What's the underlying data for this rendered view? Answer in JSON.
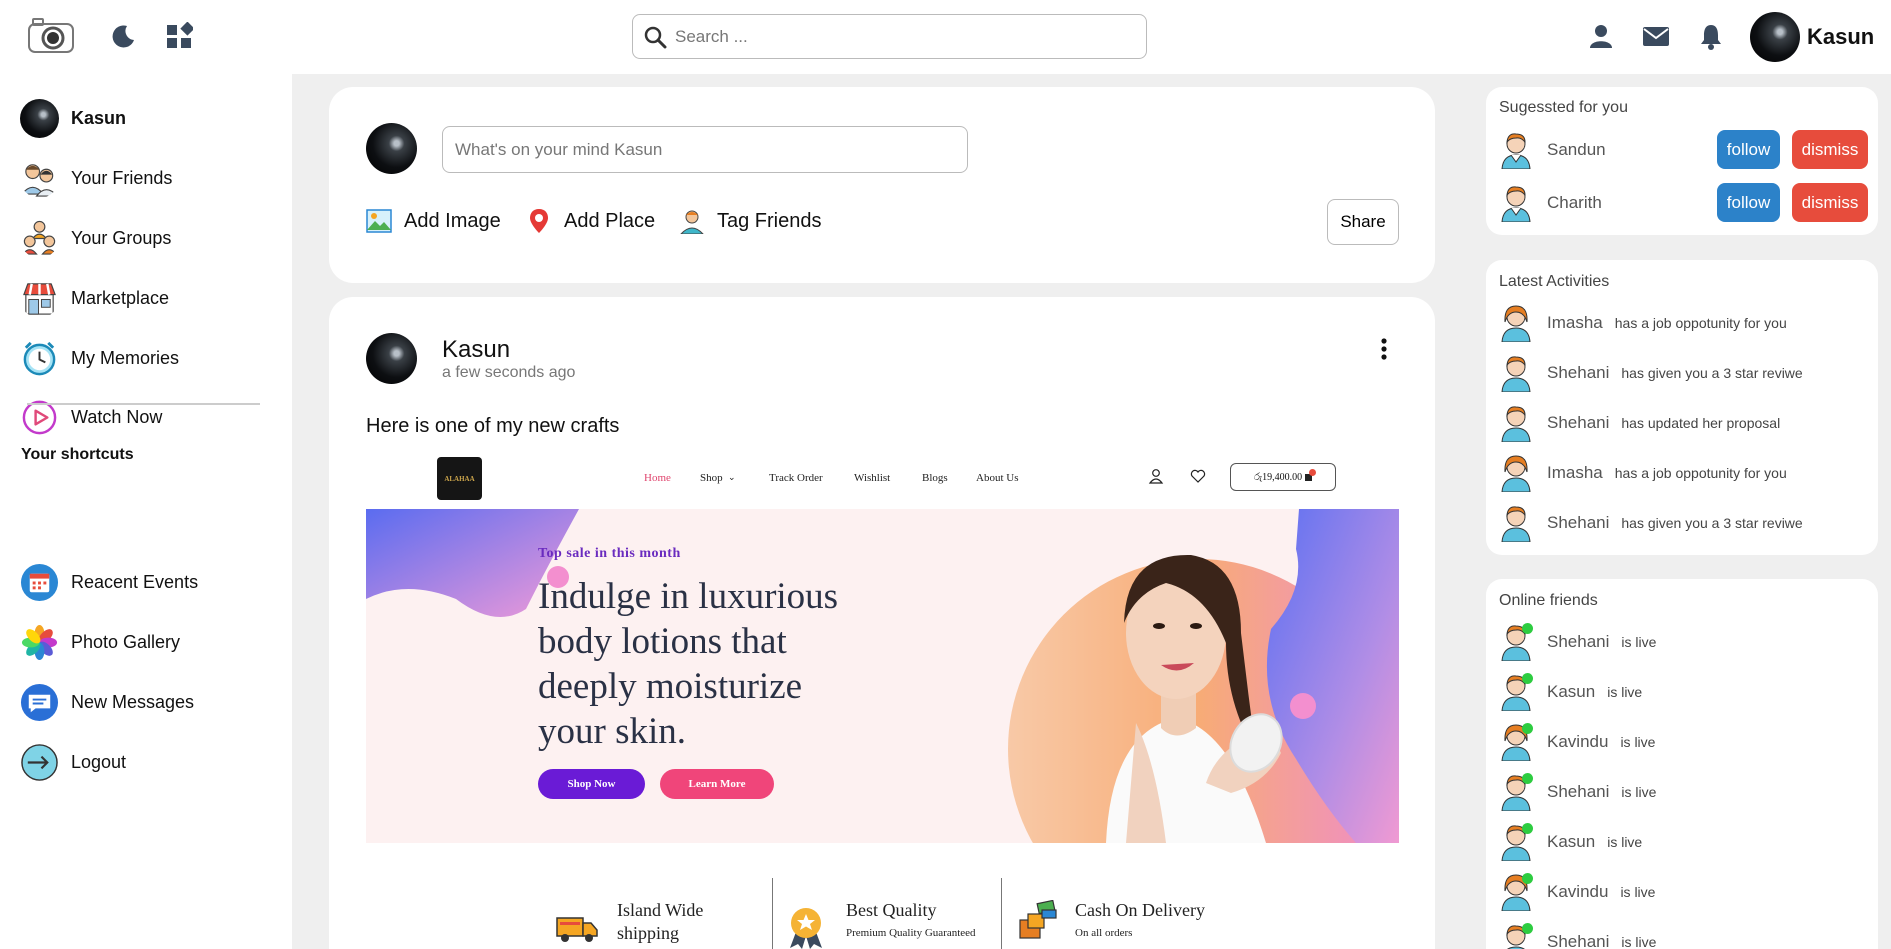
{
  "header": {
    "search_placeholder": "Search ...",
    "username": "Kasun"
  },
  "sidebar": {
    "profile_name": "Kasun",
    "items": [
      {
        "label": "Your Friends",
        "icon": "friends-icon"
      },
      {
        "label": "Your Groups",
        "icon": "groups-icon"
      },
      {
        "label": "Marketplace",
        "icon": "marketplace-icon"
      },
      {
        "label": "My Memories",
        "icon": "clock-icon"
      },
      {
        "label": "Watch Now",
        "icon": "play-icon"
      }
    ],
    "shortcuts_title": "Your shortcuts",
    "shortcuts": [
      {
        "label": "Reacent Events",
        "icon": "calendar-icon"
      },
      {
        "label": "Photo Gallery",
        "icon": "photos-icon"
      },
      {
        "label": "New Messages",
        "icon": "message-icon"
      },
      {
        "label": "Logout",
        "icon": "logout-icon"
      }
    ]
  },
  "composer": {
    "placeholder": "What's on your mind Kasun",
    "actions": [
      "Add Image",
      "Add Place",
      "Tag Friends"
    ],
    "share_label": "Share"
  },
  "post": {
    "author": "Kasun",
    "time": "a few seconds ago",
    "text": "Here is one of my new crafts",
    "image": {
      "nav": [
        "Home",
        "Shop",
        "Track Order",
        "Wishlist",
        "Blogs",
        "About Us"
      ],
      "logo_text": "ALAHAA",
      "cart": "රු19,400.00",
      "tagline": "Top sale in this month",
      "headline": [
        "Indulge in luxurious",
        "body lotions that",
        "deeply moisturize",
        "your skin."
      ],
      "btn_primary": "Shop Now",
      "btn_secondary": "Learn More",
      "features": [
        {
          "title": "Island Wide",
          "sub": "shipping"
        },
        {
          "title": "Best Quality",
          "sub": "Premium Quality Guaranteed"
        },
        {
          "title": "Cash On Delivery",
          "sub": "On all orders"
        }
      ]
    }
  },
  "suggested": {
    "title": "Sugessted for you",
    "follow_label": "follow",
    "dismiss_label": "dismiss",
    "people": [
      "Sandun",
      "Charith"
    ]
  },
  "activities": {
    "title": "Latest Activities",
    "items": [
      {
        "name": "Imasha",
        "text": "has a job oppotunity for you"
      },
      {
        "name": "Shehani",
        "text": "has given you a 3 star reviwe"
      },
      {
        "name": "Shehani",
        "text": "has updated her proposal"
      },
      {
        "name": "Imasha",
        "text": "has a job oppotunity for you"
      },
      {
        "name": "Shehani",
        "text": "has given you a 3 star reviwe"
      }
    ]
  },
  "online": {
    "title": "Online friends",
    "status": "is live",
    "friends": [
      "Shehani",
      "Kasun",
      "Kavindu",
      "Shehani",
      "Kasun",
      "Kavindu",
      "Shehani"
    ]
  },
  "colors": {
    "follow": "#2c82c9",
    "dismiss": "#e74c3c",
    "online": "#2ecc40",
    "shop_primary": "#6a1bd6",
    "shop_secondary": "#f0457a"
  }
}
